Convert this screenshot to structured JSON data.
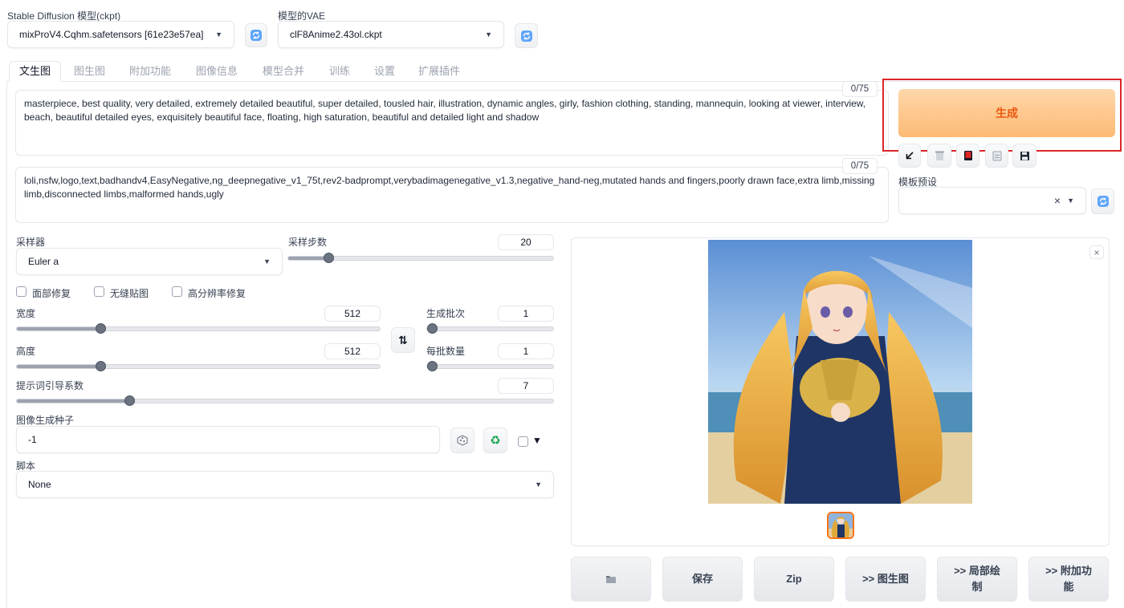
{
  "top": {
    "model_label": "Stable Diffusion 模型(ckpt)",
    "model_value": "mixProV4.Cqhm.safetensors [61e23e57ea]",
    "vae_label": "模型的VAE",
    "vae_value": "clF8Anime2.43ol.ckpt"
  },
  "tabs": [
    "文生图",
    "图生图",
    "附加功能",
    "图像信息",
    "模型合并",
    "训练",
    "设置",
    "扩展插件"
  ],
  "prompt": {
    "positive": "masterpiece, best quality, very detailed, extremely detailed beautiful, super detailed, tousled hair, illustration, dynamic angles, girly, fashion clothing, standing, mannequin, looking at viewer, interview, beach, beautiful detailed eyes, exquisitely beautiful face, floating, high saturation, beautiful and detailed light and shadow",
    "positive_counter": "0/75",
    "negative": "loli,nsfw,logo,text,badhandv4,EasyNegative,ng_deepnegative_v1_75t,rev2-badprompt,verybadimagenegative_v1.3,negative_hand-neg,mutated hands and fingers,poorly drawn face,extra limb,missing limb,disconnected limbs,malformed hands,ugly",
    "negative_counter": "0/75"
  },
  "generate": {
    "label": "生成"
  },
  "styles": {
    "label": "模板预设",
    "clear": "×"
  },
  "params": {
    "sampler_label": "采样器",
    "sampler_value": "Euler a",
    "steps_label": "采样步数",
    "steps_value": "20",
    "face_restore": "面部修复",
    "tiling": "无缝贴图",
    "hires": "高分辨率修复",
    "width_label": "宽度",
    "width_value": "512",
    "height_label": "高度",
    "height_value": "512",
    "batch_count_label": "生成批次",
    "batch_count_value": "1",
    "batch_size_label": "每批数量",
    "batch_size_value": "1",
    "cfg_label": "提示词引导系数",
    "cfg_value": "7",
    "seed_label": "图像生成种子",
    "seed_value": "-1",
    "script_label": "脚本",
    "script_value": "None"
  },
  "slider_levels": {
    "steps": 0.15,
    "width": 0.23,
    "height": 0.23,
    "cfg": 0.21,
    "batch_count": 0,
    "batch_size": 0
  },
  "output": {
    "close": "×",
    "buttons": [
      "保存",
      "Zip",
      ">> 图生图",
      ">> 局部绘制",
      ">> 附加功能"
    ]
  },
  "colors": {
    "generate_bg": "#fdba74",
    "generate_text": "#ea580c",
    "highlight_box": "#dc2626"
  }
}
